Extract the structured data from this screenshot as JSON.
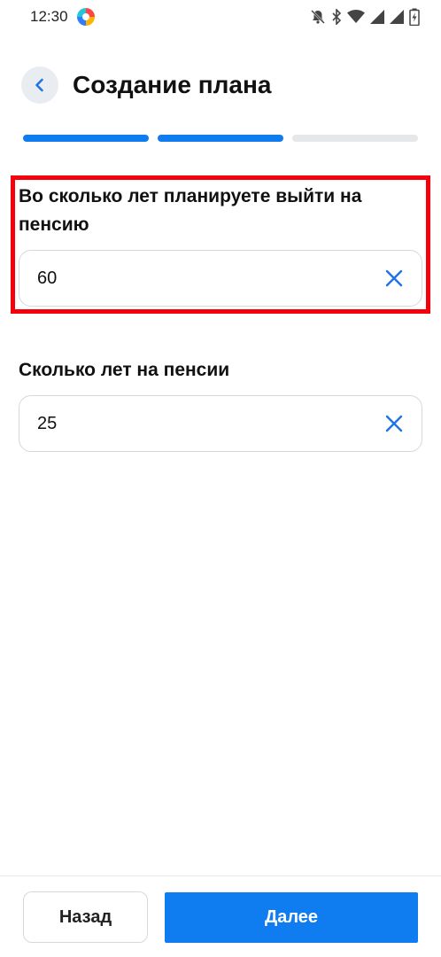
{
  "status_bar": {
    "time": "12:30",
    "icons": [
      "app-icon",
      "bell-off-icon",
      "bluetooth-icon",
      "wifi-icon",
      "signal-icon",
      "signal-icon",
      "battery-charging-icon"
    ]
  },
  "header": {
    "title": "Создание плана",
    "back_icon": "chevron-left-icon"
  },
  "progress": {
    "total_steps": 3,
    "completed_steps": 2,
    "active_color": "#0f7cf0",
    "inactive_color": "#e6e7e9"
  },
  "fields": [
    {
      "label": "Во сколько лет планируете выйти на пенсию",
      "value": "60",
      "clear_icon": "close-icon"
    },
    {
      "label": "Сколько лет на пенсии",
      "value": "25",
      "clear_icon": "close-icon"
    }
  ],
  "buttons": {
    "back_label": "Назад",
    "next_label": "Далее"
  },
  "colors": {
    "accent": "#0f7cf0",
    "highlight": "#f4000c"
  }
}
